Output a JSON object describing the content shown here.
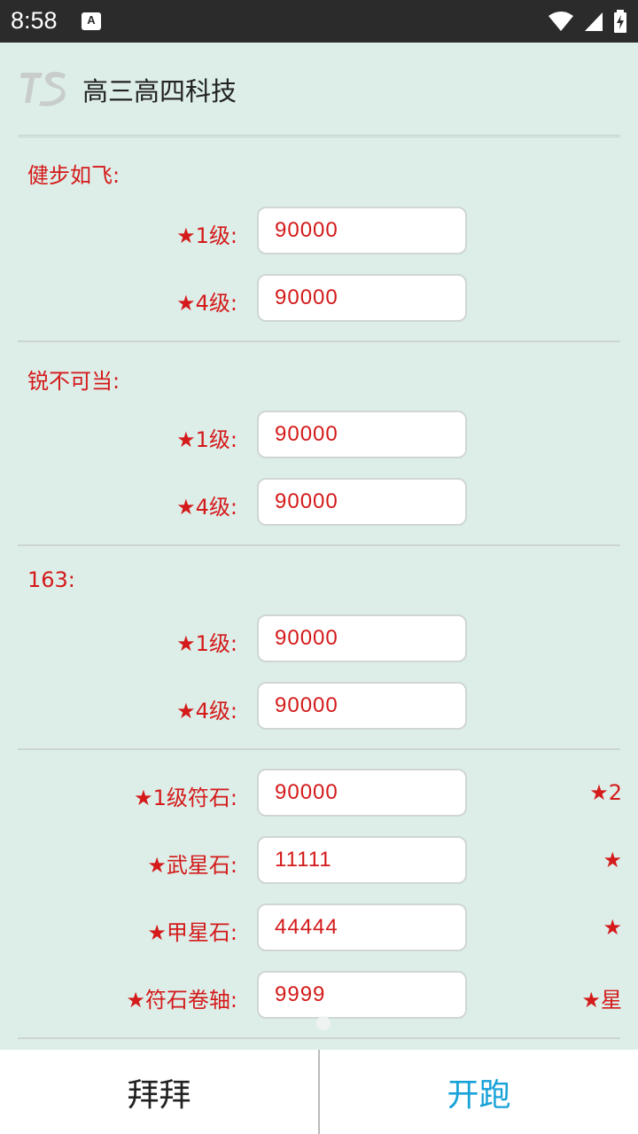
{
  "status_bar": {
    "time": "8:58",
    "notification_icon": "A"
  },
  "header": {
    "logo_icon": "ts-logo-icon",
    "title": "高三高四科技"
  },
  "sections": [
    {
      "title": "健步如飞:",
      "rows": [
        {
          "label": "★1级:",
          "value": "90000"
        },
        {
          "label": "★4级:",
          "value": "90000"
        }
      ]
    },
    {
      "title": "锐不可当:",
      "rows": [
        {
          "label": "★1级:",
          "value": "90000"
        },
        {
          "label": "★4级:",
          "value": "90000"
        }
      ]
    },
    {
      "title": "163:",
      "rows": [
        {
          "label": "★1级:",
          "value": "90000"
        },
        {
          "label": "★4级:",
          "value": "90000"
        }
      ]
    }
  ],
  "materials": [
    {
      "label": "★1级符石:",
      "value": "90000",
      "note": "★2"
    },
    {
      "label": "★武星石:",
      "value": "11111",
      "note": "★"
    },
    {
      "label": "★甲星石:",
      "value": "44444",
      "note": "★"
    },
    {
      "label": "★符石卷轴:",
      "value": "9999",
      "note": "★星"
    }
  ],
  "buttons": {
    "exit": "拜拜",
    "start": "开跑"
  },
  "colors": {
    "background": "#ddeee9",
    "accent_red": "#d41a1a",
    "start_blue": "#17a2d8"
  }
}
